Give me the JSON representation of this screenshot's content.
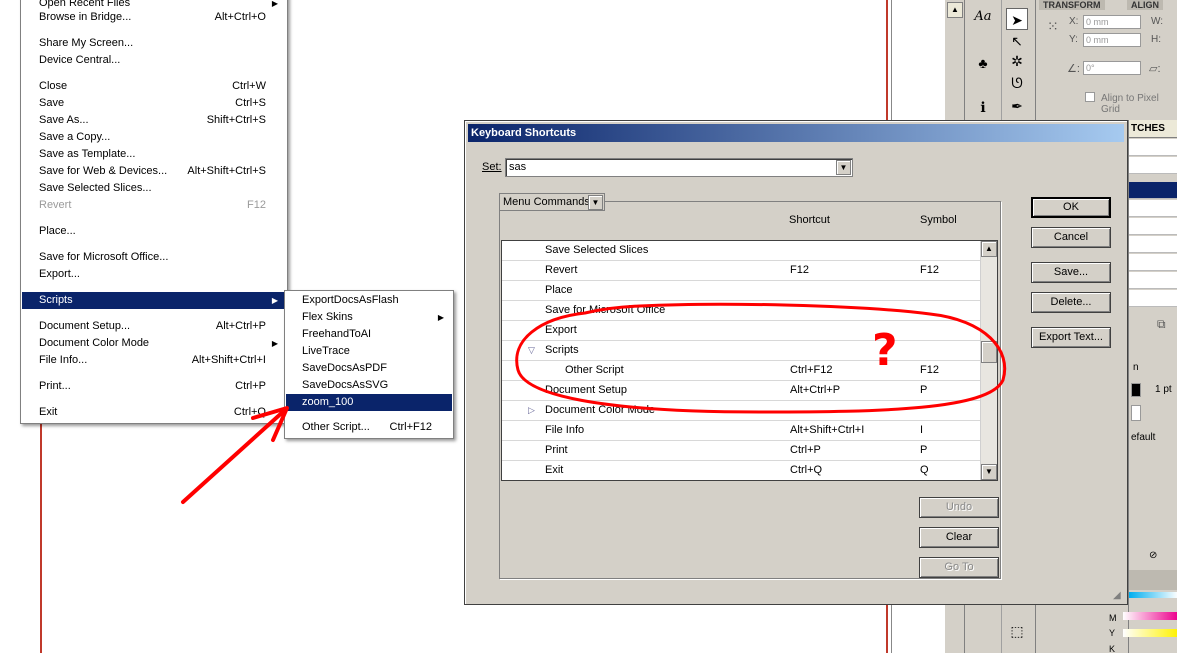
{
  "file_menu": {
    "items": [
      {
        "label": "Open Recent Files",
        "shortcut": "",
        "submenu": true
      },
      {
        "label": "Browse in Bridge...",
        "shortcut": "Alt+Ctrl+O"
      },
      {
        "label": "Share My Screen...",
        "shortcut": ""
      },
      {
        "label": "Device Central...",
        "shortcut": ""
      },
      {
        "label": "Close",
        "shortcut": "Ctrl+W"
      },
      {
        "label": "Save",
        "shortcut": "Ctrl+S"
      },
      {
        "label": "Save As...",
        "shortcut": "Shift+Ctrl+S"
      },
      {
        "label": "Save a Copy...",
        "shortcut": ""
      },
      {
        "label": "Save as Template...",
        "shortcut": ""
      },
      {
        "label": "Save for Web & Devices...",
        "shortcut": "Alt+Shift+Ctrl+S"
      },
      {
        "label": "Save Selected Slices...",
        "shortcut": ""
      },
      {
        "label": "Revert",
        "shortcut": "F12",
        "disabled": true
      },
      {
        "label": "Place...",
        "shortcut": ""
      },
      {
        "label": "Save for Microsoft Office...",
        "shortcut": ""
      },
      {
        "label": "Export...",
        "shortcut": ""
      },
      {
        "label": "Scripts",
        "shortcut": "",
        "submenu": true,
        "selected": true
      },
      {
        "label": "Document Setup...",
        "shortcut": "Alt+Ctrl+P"
      },
      {
        "label": "Document Color Mode",
        "shortcut": "",
        "submenu": true
      },
      {
        "label": "File Info...",
        "shortcut": "Alt+Shift+Ctrl+I"
      },
      {
        "label": "Print...",
        "shortcut": "Ctrl+P"
      },
      {
        "label": "Exit",
        "shortcut": "Ctrl+Q"
      }
    ]
  },
  "scripts_menu": {
    "items": [
      {
        "label": "ExportDocsAsFlash",
        "shortcut": ""
      },
      {
        "label": "Flex Skins",
        "shortcut": "",
        "submenu": true
      },
      {
        "label": "FreehandToAI",
        "shortcut": ""
      },
      {
        "label": "LiveTrace",
        "shortcut": ""
      },
      {
        "label": "SaveDocsAsPDF",
        "shortcut": ""
      },
      {
        "label": "SaveDocsAsSVG",
        "shortcut": ""
      },
      {
        "label": "zoom_100",
        "shortcut": "",
        "selected": true
      },
      {
        "label": "Other Script...",
        "shortcut": "Ctrl+F12"
      }
    ]
  },
  "dialog": {
    "title": "Keyboard Shortcuts",
    "set_label": "Set:",
    "set_value": "sas",
    "category_value": "Menu Commands",
    "col_shortcut": "Shortcut",
    "col_symbol": "Symbol",
    "rows": [
      {
        "command": "Save Selected Slices",
        "shortcut": "",
        "symbol": ""
      },
      {
        "command": "Revert",
        "shortcut": "F12",
        "symbol": "F12"
      },
      {
        "command": "Place",
        "shortcut": "",
        "symbol": ""
      },
      {
        "command": "Save for Microsoft Office",
        "shortcut": "",
        "symbol": ""
      },
      {
        "command": "Export",
        "shortcut": "",
        "symbol": ""
      },
      {
        "command": "Scripts",
        "shortcut": "",
        "symbol": "",
        "expand": "open"
      },
      {
        "command": "Other Script",
        "shortcut": "Ctrl+F12",
        "symbol": "F12",
        "indent": true
      },
      {
        "command": "Document Setup",
        "shortcut": "Alt+Ctrl+P",
        "symbol": "P"
      },
      {
        "command": "Document Color Mode",
        "shortcut": "",
        "symbol": "",
        "expand": "closed"
      },
      {
        "command": "File Info",
        "shortcut": "Alt+Shift+Ctrl+I",
        "symbol": "I"
      },
      {
        "command": "Print",
        "shortcut": "Ctrl+P",
        "symbol": "P"
      },
      {
        "command": "Exit",
        "shortcut": "Ctrl+Q",
        "symbol": "Q"
      }
    ],
    "buttons": {
      "ok": "OK",
      "cancel": "Cancel",
      "save": "Save...",
      "delete": "Delete...",
      "export_text": "Export Text...",
      "undo": "Undo",
      "clear": "Clear",
      "go_to": "Go To"
    }
  },
  "transform_panel": {
    "tab_transform": "TRANSFORM",
    "tab_align": "ALIGN",
    "x_label": "X:",
    "y_label": "Y:",
    "w_label": "W:",
    "h_label": "H:",
    "x_value": "0 mm",
    "y_value": "0 mm",
    "angle_value": "0°",
    "align_pixel": "Align to Pixel Grid"
  },
  "swatches_panel": {
    "tab": "TCHES",
    "stroke_weight": "1 pt",
    "default_label": "efault",
    "m_label": "M",
    "y_label": "Y",
    "k_label": "K"
  },
  "annotation": {
    "question_mark": "?",
    "color": "#ff0000"
  }
}
